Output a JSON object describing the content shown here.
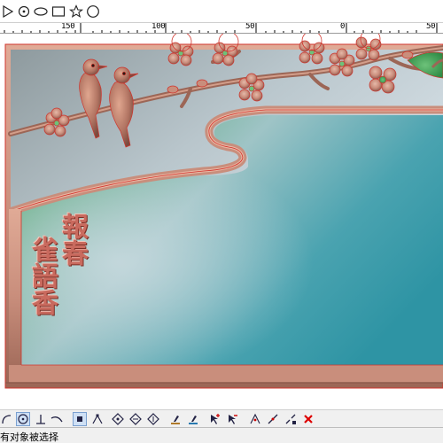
{
  "window": {
    "title": ""
  },
  "top_toolbar": {
    "tools": [
      {
        "icon": "play-triangle-icon"
      },
      {
        "icon": "circle-dot-icon"
      },
      {
        "icon": "ellipse-icon"
      },
      {
        "icon": "rectangle-icon"
      },
      {
        "icon": "star-icon"
      },
      {
        "icon": "circle-icon"
      }
    ]
  },
  "ruler": {
    "labels": [
      "150",
      "100",
      "50",
      "0",
      "50"
    ]
  },
  "canvas": {
    "artwork": "carved plaque with two birds on plum blossom branch",
    "vertical_text_1": "報春",
    "vertical_text_2": "雀語香",
    "colors": {
      "frame": "#c98e7c",
      "frame_outline": "#d0342c",
      "panel_teal": "#3a9aa6",
      "panel_green": "#4aa860",
      "sky": "#d5dde4"
    }
  },
  "bottom_toolbar": {
    "tools": [
      {
        "icon": "arc-tool-icon"
      },
      {
        "icon": "circle-center-icon",
        "active": true
      },
      {
        "icon": "perpendicular-icon"
      },
      {
        "icon": "tangent-curve-icon"
      },
      {
        "icon": "node-select-icon",
        "active": true
      },
      {
        "icon": "corner-node-icon"
      },
      {
        "icon": "diamond-nodes-icon"
      },
      {
        "icon": "diamond-nodes-2-icon"
      },
      {
        "icon": "diamond-nodes-3-icon"
      },
      {
        "icon": "stamp-tool-icon"
      },
      {
        "icon": "stamp-tool-2-icon"
      },
      {
        "icon": "cursor-plus-icon"
      },
      {
        "icon": "cursor-minus-icon"
      },
      {
        "icon": "snap-grid-icon"
      },
      {
        "icon": "weld-icon"
      },
      {
        "icon": "break-node-icon"
      },
      {
        "icon": "delete-icon"
      }
    ]
  },
  "status_bar": {
    "text": "有对象被选择"
  }
}
